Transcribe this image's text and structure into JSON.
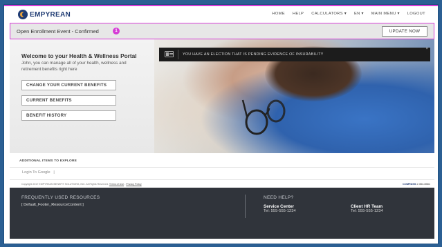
{
  "header": {
    "logo_text": "EMPYREAN",
    "nav": [
      "HOME",
      "HELP",
      "CALCULATORS ▾",
      "EN ▾",
      "MAIN MENU ▾",
      "LOGOUT"
    ]
  },
  "enrollment": {
    "text": "Open Enrollment Event - Confirmed",
    "badge": "1",
    "button": "UPDATE NOW"
  },
  "welcome": {
    "title": "Welcome to your Health & Wellness Portal",
    "subtitle": "John, you can manage all of your health, wellness and retirement benefits right here",
    "buttons": [
      "CHANGE YOUR CURRENT BENEFITS",
      "CURRENT BENEFITS",
      "BENEFIT HISTORY"
    ]
  },
  "alert": {
    "text": "YOU HAVE AN ELECTION THAT IS PENDING EVIDENCE OF INSURABILITY",
    "close": "×"
  },
  "additional": {
    "heading": "ADDITIONAL ITEMS TO EXPLORE",
    "link": "Login To Google",
    "separator": "|"
  },
  "copyright": {
    "text": "Copyright 2017 EMPYREAN BENEFIT SOLUTIONS, INC. All Rights Reserved.",
    "terms": "Terms of Use",
    "dash": "-",
    "privacy": "Privacy Policy",
    "compass_brand": "COMPASS",
    "compass_version": "2.354.8581"
  },
  "footer": {
    "resources_heading": "FREQUENTLY USED RESOURCES",
    "resources_content": "[ Default_Footer_ResourceContent ]",
    "help_heading": "NEED HELP?",
    "service_center": "Service Center",
    "service_tel": "Tel: 555-555-1234",
    "hr_team": "Client HR Team",
    "hr_tel": "Tel: 555-555-1234"
  },
  "colors": {
    "accent": "#d63bd6",
    "brand": "#1f3b73",
    "footer_bg": "#30343b",
    "outer_bg": "#2b5f93"
  }
}
